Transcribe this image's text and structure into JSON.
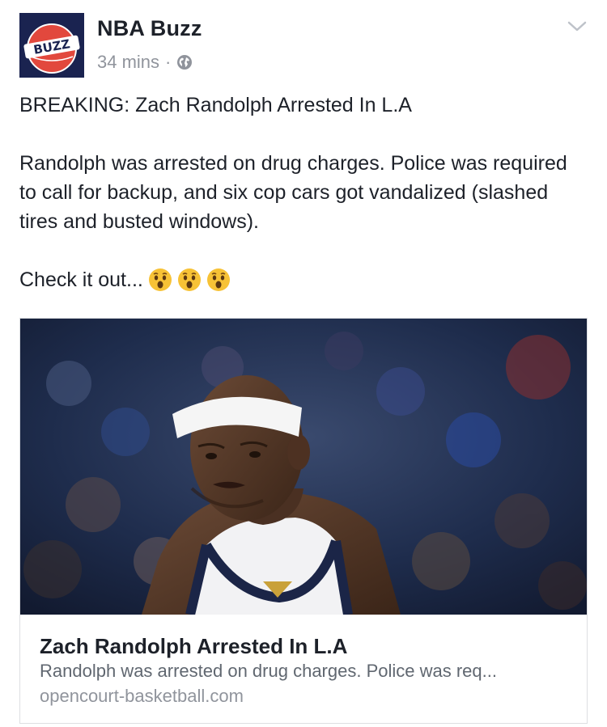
{
  "post": {
    "page_name": "NBA Buzz",
    "timestamp": "34 mins",
    "separator": "·",
    "privacy_icon": "globe-icon",
    "avatar_text": "BUZZ",
    "headline": "BREAKING: Zach Randolph Arrested In L.A",
    "body": "Randolph was arrested on drug charges. Police was required to call for backup, and six cop cars got vandalized (slashed tires and busted windows).",
    "cta_text": "Check it out...",
    "emojis": [
      "hushed-face-emoji",
      "hushed-face-emoji",
      "hushed-face-emoji"
    ]
  },
  "link_card": {
    "title": "Zach Randolph Arrested In L.A",
    "description": "Randolph was arrested on drug charges. Police was req...",
    "domain": "opencourt-basketball.com"
  },
  "colors": {
    "text_primary": "#1d2129",
    "text_secondary": "#90949c",
    "border": "#dddfe2"
  }
}
